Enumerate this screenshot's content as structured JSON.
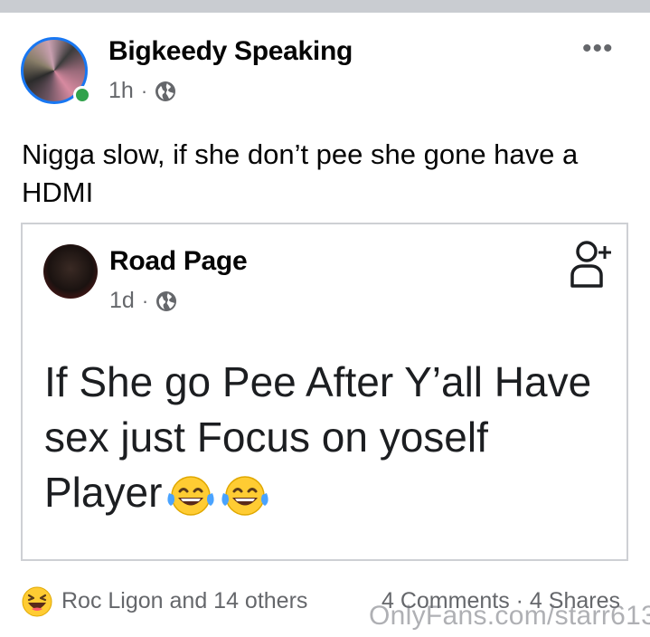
{
  "post": {
    "author": "Bigkeedy Speaking",
    "time": "1h",
    "separator": "·",
    "privacy_icon": "globe-icon",
    "more_icon": "more-icon",
    "more_label": "•••",
    "text": "Nigga slow, if she don’t pee she gone have a HDMI"
  },
  "shared_post": {
    "author": "Road Page",
    "time": "1d",
    "separator": "·",
    "privacy_icon": "globe-icon",
    "follow_icon": "add-friend-icon",
    "text": "If She go Pee After Y’all Have sex just Focus on yoself Player"
  },
  "footer": {
    "reaction_icon": "haha-emoji-icon",
    "reactions_text": "Roc Ligon and 14 others",
    "comments_shares_text": "4 Comments · 4 Shares",
    "watermark": "OnlyFans.com/starr613"
  },
  "colors": {
    "online": "#31a24c",
    "secondary_text": "#65676b",
    "border": "#ced0d4",
    "top_bar": "#c9ccd1"
  }
}
